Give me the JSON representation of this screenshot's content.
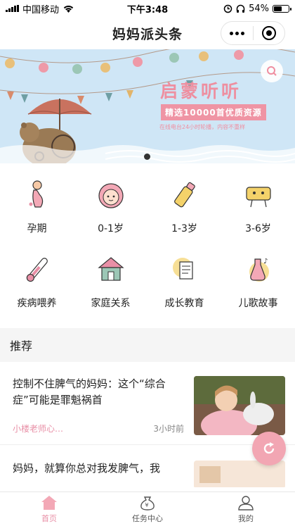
{
  "status": {
    "carrier": "中国移动",
    "time": "下午3:48",
    "battery": "54%",
    "battery_level": 0.54
  },
  "nav": {
    "title": "妈妈派头条"
  },
  "banner": {
    "title": "启蒙听听",
    "subtitle": "精选10000首优质资源",
    "note": "在线电台24小时轮播，内容不重样"
  },
  "categories": [
    {
      "label": "孕期",
      "icon": "pregnancy-icon"
    },
    {
      "label": "0-1岁",
      "icon": "baby-face-icon"
    },
    {
      "label": "1-3岁",
      "icon": "baby-bottle-icon"
    },
    {
      "label": "3-6岁",
      "icon": "toy-sponge-icon"
    },
    {
      "label": "疾病喂养",
      "icon": "thermometer-icon"
    },
    {
      "label": "家庭关系",
      "icon": "house-icon"
    },
    {
      "label": "成长教育",
      "icon": "growth-book-icon"
    },
    {
      "label": "儿歌故事",
      "icon": "music-flask-icon"
    }
  ],
  "recommend": {
    "title": "推荐"
  },
  "articles": [
    {
      "title": "控制不住脾气的妈妈：这个“综合症”可能是罪魁祸首",
      "author": "小楼老师心…",
      "time": "3小时前"
    },
    {
      "title": "妈妈，就算你总对我发脾气，我"
    }
  ],
  "tabs": [
    {
      "label": "首页",
      "icon": "home-icon",
      "active": true
    },
    {
      "label": "任务中心",
      "icon": "money-bag-icon",
      "active": false
    },
    {
      "label": "我的",
      "icon": "user-icon",
      "active": false
    }
  ],
  "colors": {
    "accent": "#e88fa6",
    "banner_bg": "#cfe6f6",
    "float": "#f2a6b3"
  }
}
